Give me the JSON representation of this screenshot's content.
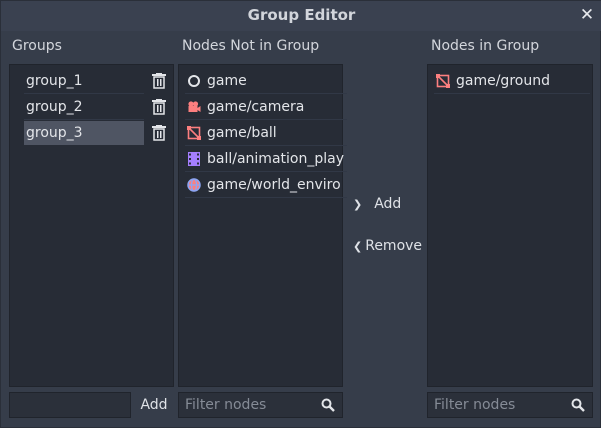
{
  "dialog": {
    "title": "Group Editor",
    "close_glyph": "✕"
  },
  "groups": {
    "label": "Groups",
    "items": [
      {
        "name": "group_1"
      },
      {
        "name": "group_2"
      },
      {
        "name": "group_3",
        "selected": true
      }
    ],
    "new_group_value": "",
    "add_label": "Add"
  },
  "not_in_group": {
    "label": "Nodes Not in Group",
    "items": [
      {
        "text": "game",
        "icon": "node-icon"
      },
      {
        "text": "game/camera",
        "icon": "camera-icon"
      },
      {
        "text": "game/ball",
        "icon": "spatial-icon"
      },
      {
        "text": "ball/animation_play",
        "icon": "animation-player-icon"
      },
      {
        "text": "game/world_enviro",
        "icon": "world-environment-icon"
      }
    ],
    "filter_placeholder": "Filter nodes"
  },
  "actions": {
    "add_glyph": "❯",
    "add_label": "Add",
    "remove_glyph": "❮",
    "remove_label": "Remove"
  },
  "in_group": {
    "label": "Nodes in Group",
    "items": [
      {
        "text": "game/ground",
        "icon": "spatial-icon"
      }
    ],
    "filter_placeholder": "Filter nodes"
  },
  "colors": {
    "background": "#363d4a",
    "panel": "#272c36",
    "selected_row": "#4f5563",
    "spatial_icon": "#fc7f7f",
    "animation_icon": "#a57fff"
  }
}
